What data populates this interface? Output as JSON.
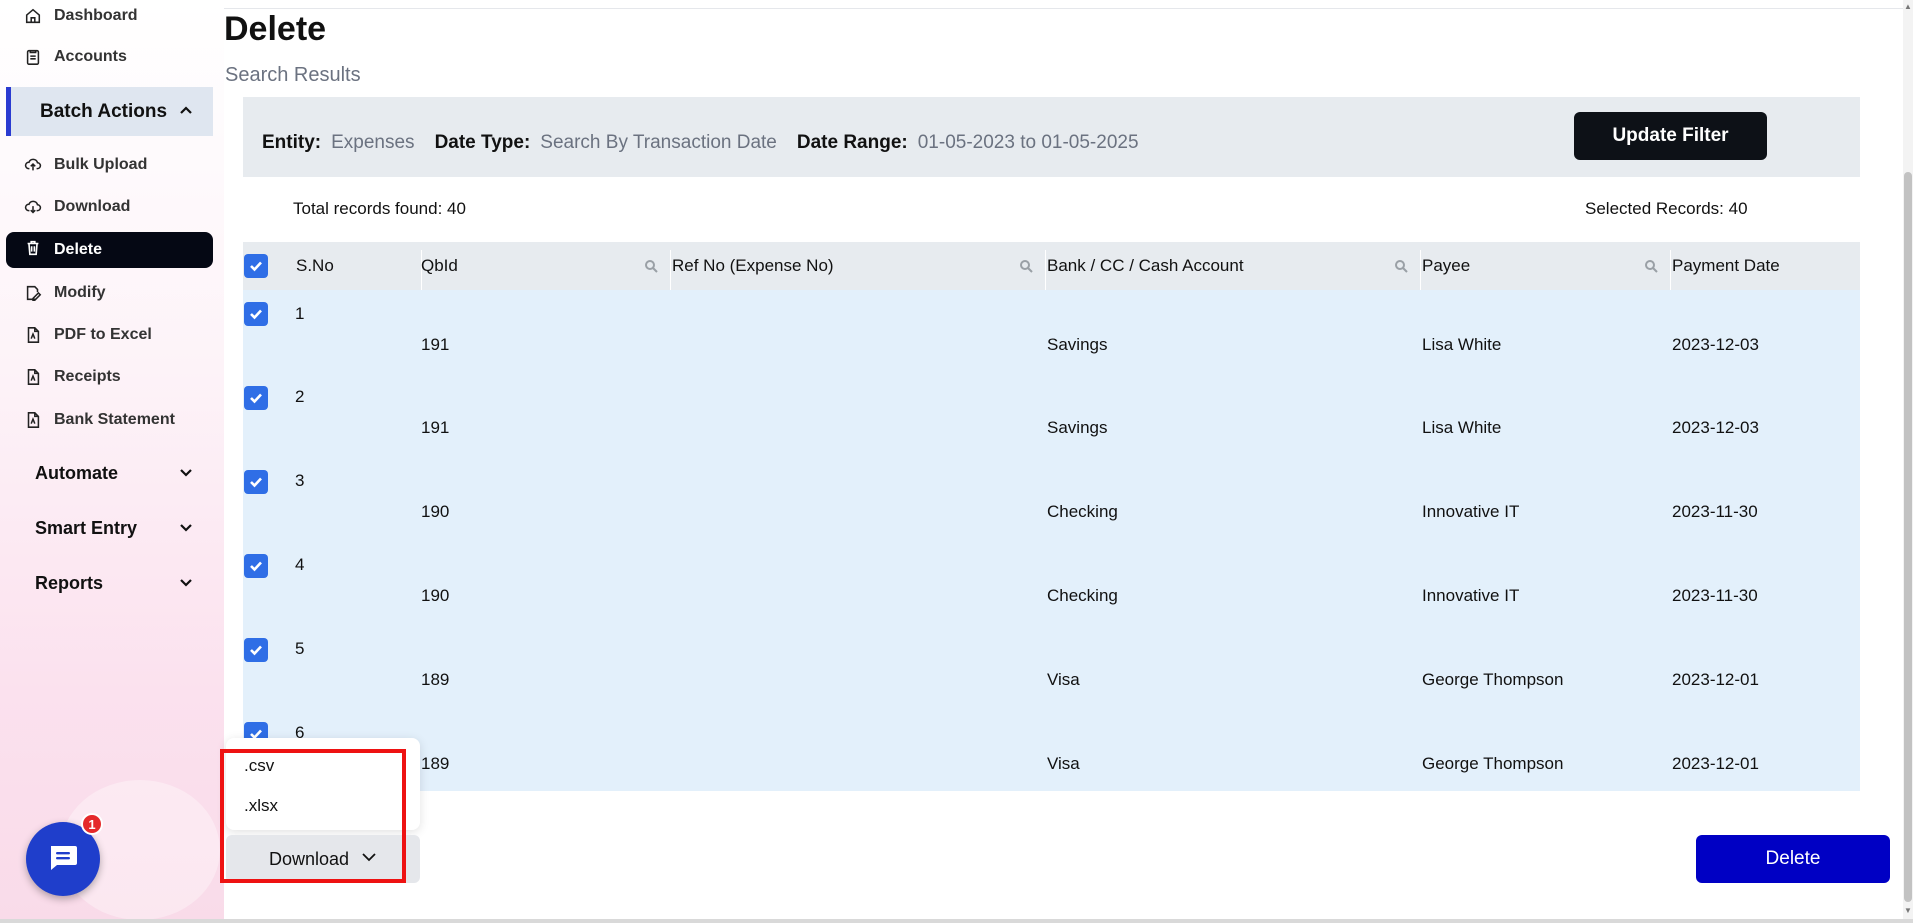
{
  "sidebar": {
    "items_top": [
      {
        "label": "Dashboard",
        "icon": "home-icon"
      },
      {
        "label": "Accounts",
        "icon": "clipboard-icon"
      }
    ],
    "batch_actions_label": "Batch Actions",
    "batch_items": [
      {
        "label": "Bulk Upload",
        "icon": "cloud-upload-icon"
      },
      {
        "label": "Download",
        "icon": "cloud-download-icon"
      },
      {
        "label": "Delete",
        "icon": "trash-icon",
        "active": true
      },
      {
        "label": "Modify",
        "icon": "edit-file-icon"
      },
      {
        "label": "PDF to Excel",
        "icon": "pdf-icon"
      },
      {
        "label": "Receipts",
        "icon": "pdf-icon"
      },
      {
        "label": "Bank Statement",
        "icon": "pdf-icon"
      }
    ],
    "groups": [
      {
        "label": "Automate"
      },
      {
        "label": "Smart Entry"
      },
      {
        "label": "Reports"
      }
    ],
    "chat_badge_count": "1"
  },
  "page": {
    "title": "Delete",
    "subtitle": "Search Results"
  },
  "filter": {
    "entity_label": "Entity:",
    "entity_value": "Expenses",
    "date_type_label": "Date Type:",
    "date_type_value": "Search By Transaction Date",
    "date_range_label": "Date Range:",
    "date_range_value": "01-05-2023 to 01-05-2025",
    "update_button": "Update Filter"
  },
  "summary": {
    "total": "Total records found: 40",
    "selected": "Selected Records: 40"
  },
  "table": {
    "columns": [
      "S.No",
      "QbId",
      "Ref No (Expense No)",
      "Bank / CC / Cash Account",
      "Payee",
      "Payment Date"
    ],
    "rows": [
      {
        "sno": "1",
        "qbid": "191",
        "ref": "",
        "account": "Savings",
        "payee": "Lisa White",
        "date": "2023-12-03"
      },
      {
        "sno": "2",
        "qbid": "191",
        "ref": "",
        "account": "Savings",
        "payee": "Lisa White",
        "date": "2023-12-03"
      },
      {
        "sno": "3",
        "qbid": "190",
        "ref": "",
        "account": "Checking",
        "payee": "Innovative IT",
        "date": "2023-11-30"
      },
      {
        "sno": "4",
        "qbid": "190",
        "ref": "",
        "account": "Checking",
        "payee": "Innovative IT",
        "date": "2023-11-30"
      },
      {
        "sno": "5",
        "qbid": "189",
        "ref": "",
        "account": "Visa",
        "payee": "George Thompson",
        "date": "2023-12-01"
      },
      {
        "sno": "6",
        "qbid": "189",
        "ref": "",
        "account": "Visa",
        "payee": "George Thompson",
        "date": "2023-12-01"
      }
    ]
  },
  "download_menu": {
    "options": [
      ".csv",
      ".xlsx"
    ],
    "button_label": "Download"
  },
  "actions": {
    "delete_button": "Delete"
  },
  "colors": {
    "accent": "#0000c4",
    "checkbox": "#2f6ee6",
    "row_bg": "#e3f0fb",
    "highlight": "#ee1212"
  }
}
